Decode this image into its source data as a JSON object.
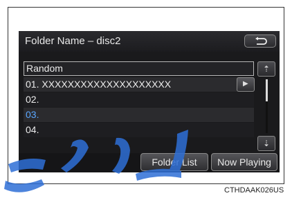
{
  "header": {
    "title": "Folder Name",
    "separator": "–",
    "subtitle": "disc2",
    "back_icon": "return-arrow-icon"
  },
  "folders": [
    {
      "label": "Random",
      "state": "selected"
    },
    {
      "label": "01. XXXXXXXXXXXXXXXXXXXX",
      "state": "playing"
    },
    {
      "label": "02.",
      "state": "normal"
    },
    {
      "label": "03.",
      "state": "highlighted"
    },
    {
      "label": "04.",
      "state": "normal"
    }
  ],
  "play_button_icon": "play-icon",
  "play_button_glyph": "▶",
  "scroll": {
    "up_glyph": "⇡",
    "down_glyph": "⇣"
  },
  "tabs": {
    "folder_list": "Folder List",
    "now_playing": "Now Playing"
  },
  "caption": "CTHDAAK026US",
  "colors": {
    "screen_bg": "#1a1a1c",
    "text": "#ececec",
    "highlight_text": "#5aa7ff",
    "watermark": "#2e6fd6"
  }
}
